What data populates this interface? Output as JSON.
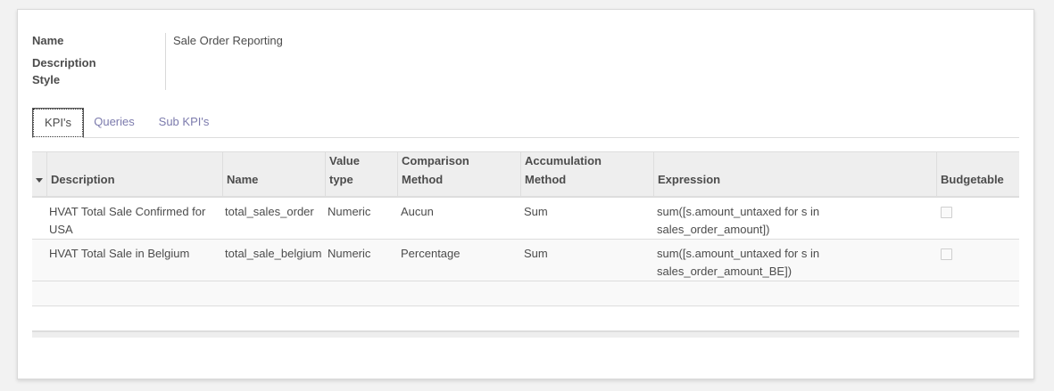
{
  "form": {
    "name_label": "Name",
    "name_value": "Sale Order Reporting",
    "description_label": "Description",
    "style_label": "Style"
  },
  "tabs": [
    {
      "label": "KPI's",
      "active": true
    },
    {
      "label": "Queries",
      "active": false
    },
    {
      "label": "Sub KPI's",
      "active": false
    }
  ],
  "table": {
    "headers": {
      "description": "Description",
      "name": "Name",
      "value_type": "Value type",
      "comparison_method": "Comparison Method",
      "accumulation_method": "Accumulation Method",
      "expression": "Expression",
      "budgetable": "Budgetable"
    },
    "rows": [
      {
        "description": "HVAT Total Sale Confirmed for USA",
        "name": "total_sales_order",
        "value_type": "Numeric",
        "comparison_method": "Aucun",
        "accumulation_method": "Sum",
        "expression": "sum([s.amount_untaxed for s in sales_order_amount])",
        "budgetable": false
      },
      {
        "description": "HVAT Total Sale in Belgium",
        "name": "total_sale_belgium",
        "value_type": "Numeric",
        "comparison_method": "Percentage",
        "accumulation_method": "Sum",
        "expression": "sum([s.amount_untaxed for s in sales_order_amount_BE])",
        "budgetable": false
      }
    ]
  },
  "colors": {
    "link_tab": "#7c7bad",
    "text": "#4c4c4c",
    "header_bg": "#eeeeee",
    "border": "#dddddd"
  }
}
